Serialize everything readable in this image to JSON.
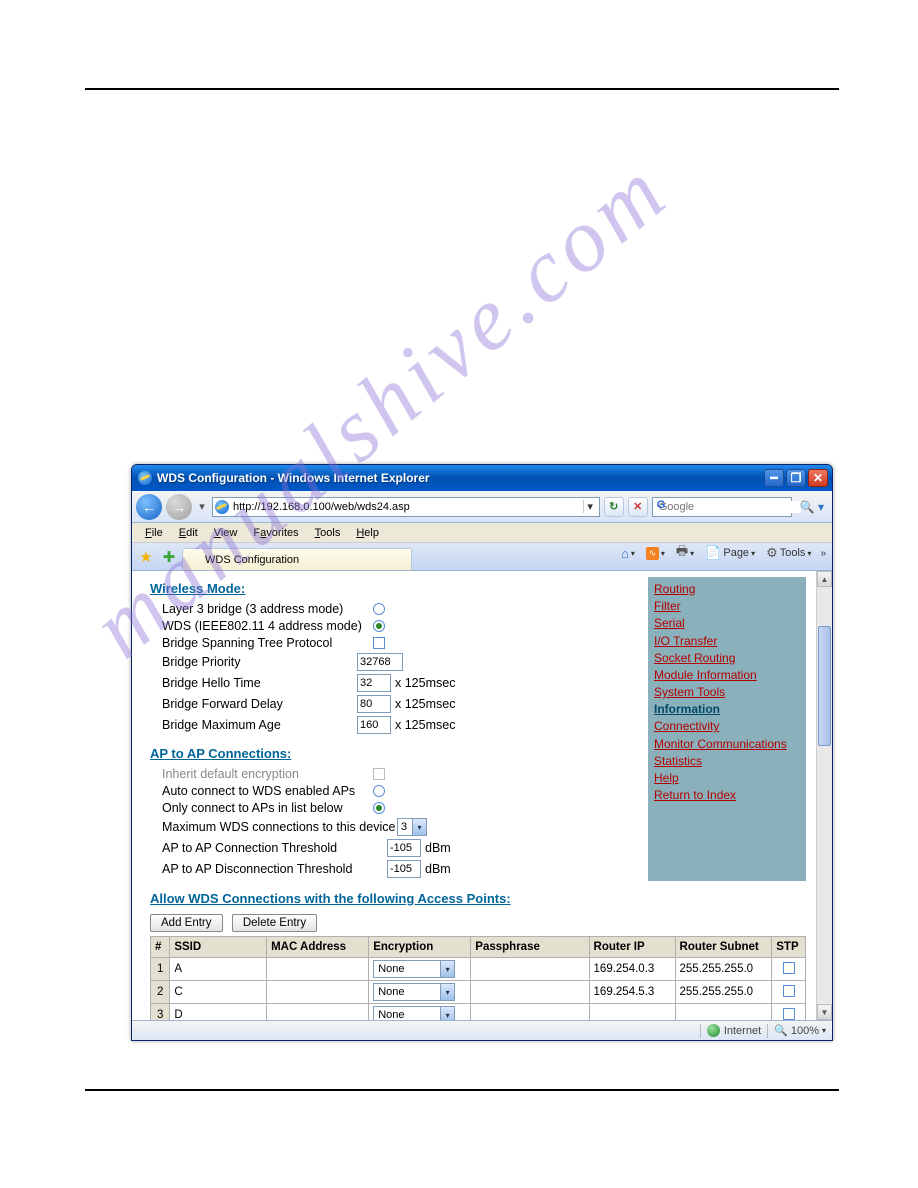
{
  "window": {
    "title": "WDS Configuration - Windows Internet Explorer",
    "address": "http://192.168.0.100/web/wds24.asp",
    "search_placeholder": "Google",
    "tab_title": "WDS Configuration",
    "status_zone": "Internet",
    "status_zoom": "100%"
  },
  "menu": {
    "file": "File",
    "edit": "Edit",
    "view": "View",
    "favorites": "Favorites",
    "tools": "Tools",
    "help": "Help"
  },
  "toolbar": {
    "page": "Page",
    "tools": "Tools"
  },
  "sections": {
    "wireless_mode": "Wireless Mode:",
    "ap_connections": "AP to AP Connections:",
    "allow": "Allow WDS Connections with the following Access Points:"
  },
  "labels": {
    "layer3": "Layer 3 bridge (3 address mode)",
    "wds": "WDS (IEEE802.11 4 address mode)",
    "stp": "Bridge Spanning Tree Protocol",
    "priority": "Bridge Priority",
    "hello": "Bridge Hello Time",
    "fwd": "Bridge Forward Delay",
    "maxage": "Bridge Maximum Age",
    "inherit": "Inherit default encryption",
    "auto": "Auto connect to WDS enabled APs",
    "only": "Only connect to APs in list below",
    "maxconn": "Maximum WDS connections to this device",
    "connth": "AP to AP Connection Threshold",
    "discth": "AP to AP Disconnection Threshold",
    "unit_ms": "x 125msec",
    "unit_dbm": "dBm"
  },
  "values": {
    "priority": "32768",
    "hello": "32",
    "fwd": "80",
    "maxage": "160",
    "maxconn": "3",
    "connth": "-105",
    "discth": "-105"
  },
  "buttons": {
    "add": "Add Entry",
    "delete": "Delete Entry"
  },
  "table": {
    "headers": {
      "num": "#",
      "ssid": "SSID",
      "mac": "MAC Address",
      "enc": "Encryption",
      "pass": "Passphrase",
      "rip": "Router IP",
      "rsub": "Router Subnet",
      "stp": "STP"
    },
    "rows": [
      {
        "n": "1",
        "ssid": "A",
        "mac": "",
        "enc": "None",
        "pass": "",
        "rip": "169.254.0.3",
        "rsub": "255.255.255.0"
      },
      {
        "n": "2",
        "ssid": "C",
        "mac": "",
        "enc": "None",
        "pass": "",
        "rip": "169.254.5.3",
        "rsub": "255.255.255.0"
      },
      {
        "n": "3",
        "ssid": "D",
        "mac": "",
        "enc": "None",
        "pass": "",
        "rip": "",
        "rsub": ""
      }
    ]
  },
  "sidebar": {
    "links_top": [
      "Routing",
      "Filter",
      "Serial",
      "I/O Transfer",
      "Socket Routing",
      "Module Information",
      "System Tools"
    ],
    "group": "Information",
    "links_bot": [
      "Connectivity",
      "Monitor Communications",
      "Statistics",
      "Help",
      "Return to Index"
    ]
  },
  "watermark": "manualshive.com"
}
